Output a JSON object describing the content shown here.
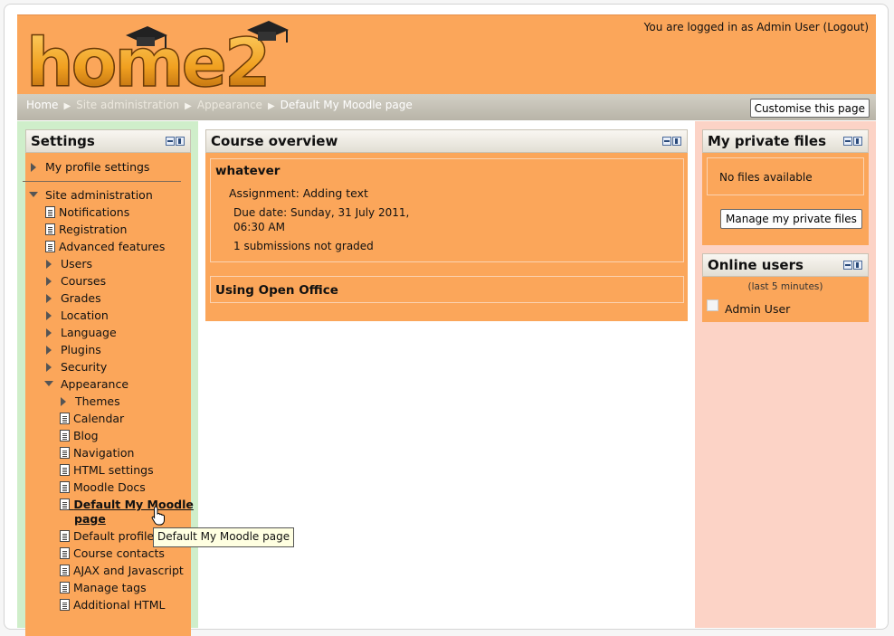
{
  "header": {
    "logo_text": "home2",
    "login_prefix": "You are logged in as ",
    "login_user": "Admin User",
    "logout": "(Logout)"
  },
  "breadcrumb": [
    "Home",
    "Site administration",
    "Appearance",
    "Default My Moodle page"
  ],
  "customise_button": "Customise this page",
  "settings": {
    "title": "Settings",
    "my_profile": "My profile settings",
    "site_admin": "Site administration",
    "items_l1": [
      "Notifications",
      "Registration",
      "Advanced features"
    ],
    "folders_l1": [
      "Users",
      "Courses",
      "Grades",
      "Location",
      "Language",
      "Plugins",
      "Security"
    ],
    "appearance": "Appearance",
    "themes": "Themes",
    "appearance_items": [
      "Calendar",
      "Blog",
      "Navigation",
      "HTML settings",
      "Moodle Docs"
    ],
    "current_line1": "Default My Moodle",
    "current_line2": "page",
    "more_items": [
      "Default profile p",
      "Course contacts",
      "AJAX and Javascript",
      "Manage tags",
      "Additional HTML"
    ]
  },
  "tooltip": "Default My Moodle page",
  "course_overview": {
    "title": "Course overview",
    "course1": "whatever",
    "assignment": "Assignment: Adding text",
    "due_line1": "Due date: Sunday, 31 July 2011,",
    "due_line2": "06:30 AM",
    "submissions": "1 submissions not graded",
    "course2": "Using Open Office"
  },
  "private_files": {
    "title": "My private files",
    "empty": "No files available",
    "button": "Manage my private files"
  },
  "online_users": {
    "title": "Online users",
    "period": "(last 5 minutes)",
    "user": "Admin User"
  },
  "colors": {
    "accent_orange": "#fba65a",
    "left_column": "#cfeeca",
    "right_column": "#fcd3c6"
  }
}
